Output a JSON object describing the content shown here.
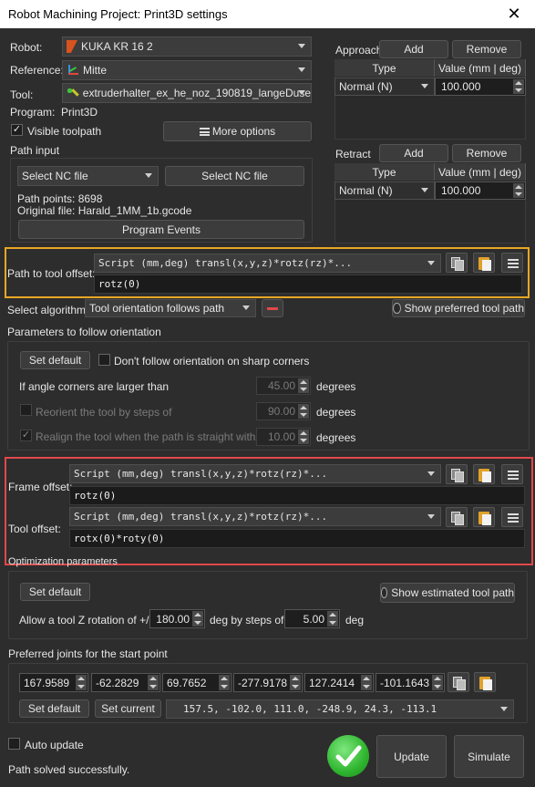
{
  "window": {
    "title": "Robot Machining Project: Print3D settings",
    "close_glyph": "✕"
  },
  "robot": {
    "label": "Robot:",
    "value": "KUKA KR 16 2"
  },
  "reference": {
    "label": "Reference:",
    "value": "Mitte"
  },
  "tool": {
    "label": "Tool:",
    "value": "extruderhalter_ex_he_noz_190819_langeDuse"
  },
  "program": {
    "label": "Program:",
    "value": "Print3D"
  },
  "visible_toolpath": {
    "label": "Visible toolpath",
    "checked": true
  },
  "more_options": "More options",
  "path_input": {
    "label": "Path input",
    "select_combo": "Select NC file",
    "select_button": "Select NC file",
    "path_points": "Path points: 8698",
    "original_file": "Original file: Harald_1MM_1b.gcode",
    "program_events": "Program Events"
  },
  "approach": {
    "label": "Approach",
    "add": "Add",
    "remove": "Remove",
    "col_type": "Type",
    "col_value": "Value (mm | deg)",
    "row_type": "Normal (N)",
    "row_value": "100.000"
  },
  "retract": {
    "label": "Retract",
    "add": "Add",
    "remove": "Remove",
    "col_type": "Type",
    "col_value": "Value (mm | deg)",
    "row_type": "Normal (N)",
    "row_value": "100.000"
  },
  "path_to_tool_offset": {
    "label": "Path to tool offset:",
    "script": "Script (mm,deg) transl(x,y,z)*rotz(rz)*...",
    "value": "rotz(0)"
  },
  "algorithm": {
    "label": "Select algorithm:",
    "value": "Tool orientation follows path",
    "show_preferred": "Show preferred tool path"
  },
  "follow_orientation": {
    "label": "Parameters to follow orientation",
    "set_default": "Set default",
    "dont_follow": "Don't follow orientation on sharp corners",
    "angle_label": "If angle corners are larger than",
    "angle_value": "45.00",
    "angle_unit": "degrees",
    "reorient_label": "Reorient the tool by steps of",
    "reorient_value": "90.00",
    "reorient_unit": "degrees",
    "realign_label": "Realign the tool when the path is straight within",
    "realign_value": "10.00",
    "realign_unit": "degrees"
  },
  "frame_offset": {
    "label": "Frame offset:",
    "script": "Script (mm,deg) transl(x,y,z)*rotz(rz)*...",
    "value": "rotz(0)"
  },
  "tool_offset": {
    "label": "Tool offset:",
    "script": "Script (mm,deg) transl(x,y,z)*rotz(rz)*...",
    "value": "rotx(0)*roty(0)"
  },
  "optimization": {
    "label": "Optimization parameters",
    "set_default": "Set default",
    "show_estimated": "Show estimated tool path",
    "allow_label": "Allow a tool Z rotation of +/-",
    "allow_value": "180.00",
    "steps_label": "deg by steps of",
    "steps_value": "5.00",
    "deg": "deg"
  },
  "preferred_joints": {
    "label": "Preferred joints for the start point",
    "joints": [
      "167.9589",
      "-62.2829",
      "69.7652",
      "-277.9178",
      "127.2414",
      "-101.1643"
    ],
    "set_default": "Set default",
    "set_current": "Set current",
    "preset": "157.5,   -102.0,    111.0,   -248.9,     24.3,   -113.1"
  },
  "auto_update": {
    "label": "Auto update",
    "checked": false
  },
  "status": "Path solved successfully.",
  "update": "Update",
  "simulate": "Simulate",
  "colors": {
    "highlight_yellow": "#e8a723",
    "highlight_red": "#e0484a",
    "success_green": "#3cc43c"
  }
}
